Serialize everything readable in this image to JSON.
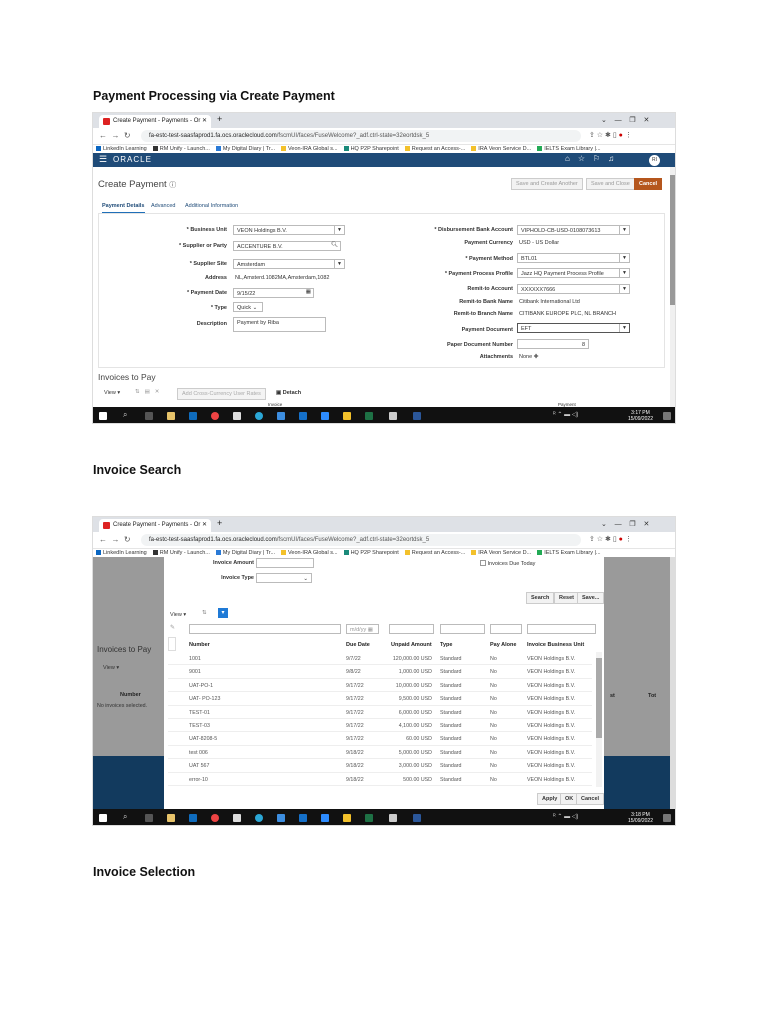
{
  "doc": {
    "heading1": "Payment Processing via Create Payment",
    "heading2": "Invoice Search",
    "heading3": "Invoice Selection"
  },
  "browser": {
    "tab_title": "Create Payment - Payments - Or",
    "url_host": "fa-estc-test-saasfaprod1.fa.ocs.oraclecloud.com",
    "url_path": "/fscmUI/faces/FuseWelcome?_adf.ctrl-state=32eortdsk_5",
    "bookmarks": [
      "LinkedIn Learning",
      "RM Unify - Launch...",
      "My Digital Diary | Tr...",
      "Veon-IRA Global s...",
      "HQ P2P Sharepoint",
      "Request an Access-...",
      "IRA Veon Service D...",
      "IELTS Exam Library |..."
    ]
  },
  "app": {
    "logo": "ORACLE",
    "avatar": "RI"
  },
  "create_payment": {
    "title": "Create Payment",
    "buttons": {
      "save_another": "Save and Create Another",
      "save_close": "Save and Close",
      "cancel": "Cancel"
    },
    "tabs": [
      "Payment Details",
      "Advanced",
      "Additional Information"
    ],
    "left": {
      "business_unit_label": "* Business Unit",
      "business_unit": "VEON Holdings B.V.",
      "supplier_label": "* Supplier or Party",
      "supplier": "ACCENTURE B.V.",
      "site_label": "* Supplier Site",
      "site": "Amsterdam",
      "address_label": "Address",
      "address": "NL,Amsterd.1082MA,Amsterdam,1082",
      "date_label": "* Payment Date",
      "date": "9/15/22",
      "type_label": "* Type",
      "type": "Quick",
      "desc_label": "Description",
      "desc": "Payment by Riba"
    },
    "right": {
      "bank_label": "* Disbursement Bank Account",
      "bank": "VIPHOLD-CB-USD-0108073613",
      "currency_label": "Payment Currency",
      "currency": "USD - US Dollar",
      "method_label": "* Payment Method",
      "method": "BTL01",
      "profile_label": "* Payment Process Profile",
      "profile": "Jazz HQ Payment Process Profile",
      "remit_label": "Remit-to Account",
      "remit": "XXXXXX7666",
      "bankname_label": "Remit-to Bank Name",
      "bankname": "Citibank International Ltd",
      "branch_label": "Remit-to Branch Name",
      "branch": "CITIBANK EUROPE PLC, NL BRANCH",
      "doc_label": "Payment Document",
      "doc": "EFT",
      "paper_label": "Paper Document Number",
      "paper": "8",
      "attach_label": "Attachments",
      "attach": "None"
    },
    "invoices_title": "Invoices to Pay",
    "view": "View",
    "add_rates": "Add Cross-Currency User Rates",
    "detach": "Detach",
    "col_invoice": "Invoice",
    "col_payment": "Payment"
  },
  "taskbar1": {
    "time": "3:17 PM",
    "date": "15/09/2022"
  },
  "taskbar2": {
    "time": "3:18 PM",
    "date": "15/09/2022"
  },
  "search": {
    "amount_label": "Invoice Amount",
    "type_label": "Invoice Type",
    "due_today": "Invoices Due Today",
    "search": "Search",
    "reset": "Reset",
    "save": "Save...",
    "view": "View",
    "date_ph": "m/d/yy",
    "columns": [
      "Number",
      "Due Date",
      "Unpaid Amount",
      "Type",
      "Pay Alone",
      "Invoice Business Unit"
    ],
    "rows": [
      [
        "1001",
        "9/7/22",
        "120,000.00 USD",
        "Standard",
        "No",
        "VEON Holdings B.V."
      ],
      [
        "9001",
        "9/8/22",
        "1,000.00 USD",
        "Standard",
        "No",
        "VEON Holdings B.V."
      ],
      [
        "UAT-PO-1",
        "9/17/22",
        "10,000.00 USD",
        "Standard",
        "No",
        "VEON Holdings B.V."
      ],
      [
        "UAT- PO-123",
        "9/17/22",
        "9,500.00 USD",
        "Standard",
        "No",
        "VEON Holdings B.V."
      ],
      [
        "TEST-01",
        "9/17/22",
        "6,000.00 USD",
        "Standard",
        "No",
        "VEON Holdings B.V."
      ],
      [
        "TEST-03",
        "9/17/22",
        "4,100.00 USD",
        "Standard",
        "No",
        "VEON Holdings B.V."
      ],
      [
        "UAT-8208-5",
        "9/17/22",
        "60.00 USD",
        "Standard",
        "No",
        "VEON Holdings B.V."
      ],
      [
        "test 006",
        "9/18/22",
        "5,000.00 USD",
        "Standard",
        "No",
        "VEON Holdings B.V."
      ],
      [
        "UAT 567",
        "9/18/22",
        "3,000.00 USD",
        "Standard",
        "No",
        "VEON Holdings B.V."
      ],
      [
        "error-10",
        "9/18/22",
        "500.00 USD",
        "Standard",
        "No",
        "VEON Holdings B.V."
      ]
    ],
    "apply": "Apply",
    "ok": "OK",
    "cancel": "Cancel",
    "bg": {
      "invoices_title": "Invoices to Pay",
      "view": "View",
      "number": "Number",
      "empty": "No invoices selected.",
      "col_st": "st",
      "col_tot": "Tot"
    }
  }
}
